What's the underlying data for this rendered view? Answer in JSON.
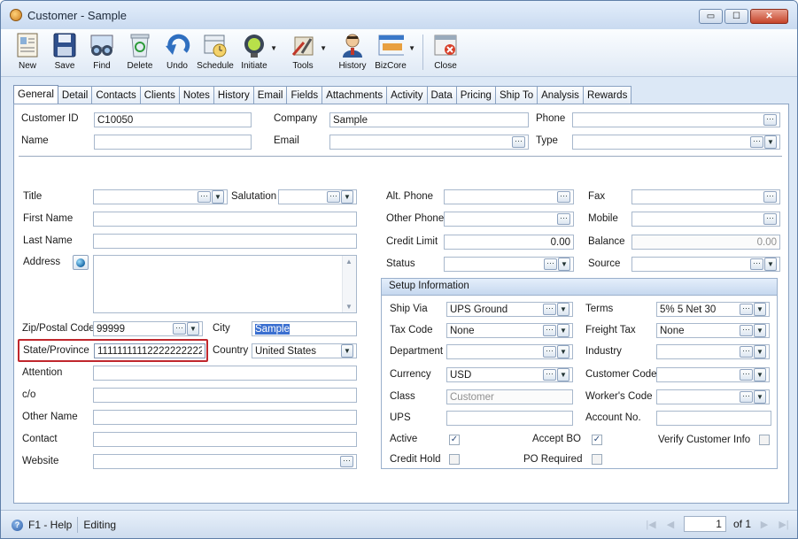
{
  "window": {
    "title": "Customer - Sample",
    "buttons": {
      "minimize": "▭",
      "maximize": "☐",
      "close": "✕"
    }
  },
  "toolbar": {
    "items": [
      {
        "label": "New",
        "icon": "new-record-icon"
      },
      {
        "label": "Save",
        "icon": "floppy-disk-icon"
      },
      {
        "label": "Find",
        "icon": "binoculars-icon"
      },
      {
        "label": "Delete",
        "icon": "recycle-bin-icon"
      },
      {
        "label": "Undo",
        "icon": "undo-arrow-icon"
      },
      {
        "label": "Schedule",
        "icon": "schedule-clock-icon"
      },
      {
        "label": "Initiate",
        "icon": "traffic-light-icon"
      },
      {
        "label": "Tools",
        "icon": "tools-icon"
      },
      {
        "label": "History",
        "icon": "history-person-icon"
      },
      {
        "label": "BizCore",
        "icon": "bizcore-icon"
      },
      {
        "label": "Close",
        "icon": "close-window-icon"
      }
    ]
  },
  "tabs": [
    "General",
    "Detail",
    "Contacts",
    "Clients",
    "Notes",
    "History",
    "Email",
    "Fields",
    "Attachments",
    "Activity",
    "Data",
    "Pricing",
    "Ship To",
    "Analysis",
    "Rewards"
  ],
  "header": {
    "customer_id_label": "Customer ID",
    "customer_id": "C10050",
    "company_label": "Company",
    "company": "Sample",
    "phone_label": "Phone",
    "phone": "",
    "name_label": "Name",
    "name": "",
    "email_label": "Email",
    "email": "",
    "type_label": "Type",
    "type": ""
  },
  "left": {
    "title_label": "Title",
    "title": "",
    "salutation_label": "Salutation",
    "salutation": "",
    "first_name_label": "First Name",
    "first_name": "",
    "last_name_label": "Last Name",
    "last_name": "",
    "address_label": "Address",
    "address": "",
    "zip_label": "Zip/Postal Code",
    "zip": "99999",
    "city_label": "City",
    "city": "Sample",
    "state_label": "State/Province",
    "state": "11111111112222222222",
    "country_label": "Country",
    "country": "United States",
    "attention_label": "Attention",
    "co_label": "c/o",
    "other_name_label": "Other Name",
    "contact_label": "Contact",
    "website_label": "Website"
  },
  "middle": {
    "alt_phone_label": "Alt. Phone",
    "other_phone_label": "Other Phone",
    "credit_limit_label": "Credit Limit",
    "credit_limit": "0.00",
    "status_label": "Status"
  },
  "right": {
    "fax_label": "Fax",
    "mobile_label": "Mobile",
    "balance_label": "Balance",
    "balance": "0.00",
    "source_label": "Source"
  },
  "setup": {
    "header": "Setup Information",
    "ship_via_label": "Ship Via",
    "ship_via": "UPS Ground",
    "tax_code_label": "Tax Code",
    "tax_code": "None",
    "department_label": "Department",
    "currency_label": "Currency",
    "currency": "USD",
    "class_label": "Class",
    "class": "Customer",
    "ups_label": "UPS",
    "active_label": "Active",
    "active": true,
    "credit_hold_label": "Credit Hold",
    "credit_hold": false,
    "terms_label": "Terms",
    "terms": "5% 5 Net 30",
    "freight_tax_label": "Freight Tax",
    "freight_tax": "None",
    "industry_label": "Industry",
    "customer_code_label": "Customer Code",
    "workers_code_label": "Worker's Code",
    "account_no_label": "Account No.",
    "accept_bo_label": "Accept BO",
    "accept_bo": true,
    "po_required_label": "PO Required",
    "po_required": false,
    "verify_label": "Verify Customer Info",
    "verify": false
  },
  "status": {
    "help": "F1 - Help",
    "mode": "Editing",
    "page": "1",
    "of": "of 1"
  },
  "colors": {
    "accent": "#3a6fd0",
    "highlight_border": "#c0272d"
  }
}
